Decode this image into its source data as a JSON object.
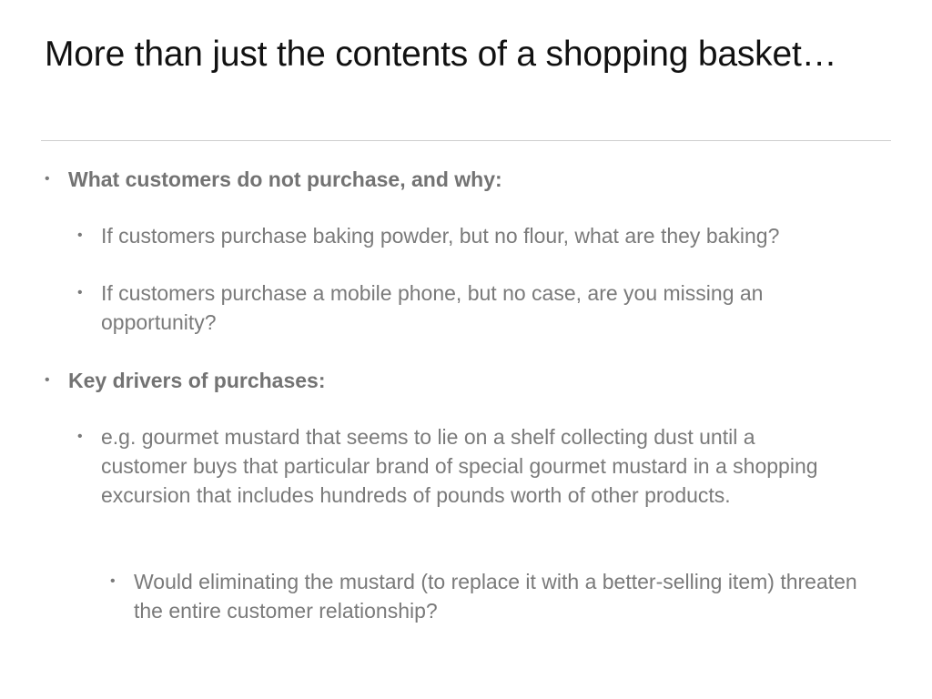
{
  "slide": {
    "title": "More than just the contents of a shopping basket…",
    "bullets": [
      {
        "level": 1,
        "text": "What customers do not purchase, and why:"
      },
      {
        "level": 2,
        "text": "If customers purchase baking powder, but no flour, what are they baking?"
      },
      {
        "level": 2,
        "text": "If customers purchase a mobile phone, but no case, are you missing an opportunity?"
      },
      {
        "level": 1,
        "text": "Key drivers of purchases:"
      },
      {
        "level": 2,
        "text": "e.g. gourmet mustard that seems to lie on a shelf collecting dust until a customer buys that particular brand of special gourmet mustard in a shopping excursion that includes hundreds of pounds worth of other products."
      },
      {
        "level": 3,
        "text": "Would eliminating the mustard (to replace it with a better-selling item) threaten the entire customer relationship?"
      }
    ],
    "bullet_glyph": "•"
  }
}
